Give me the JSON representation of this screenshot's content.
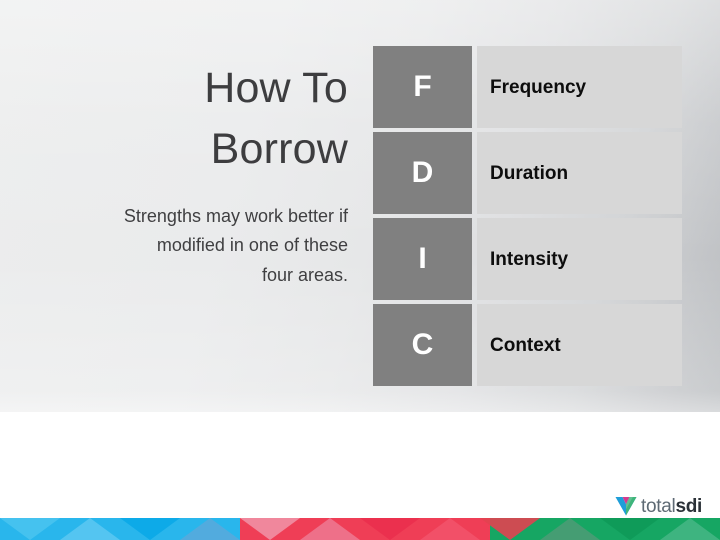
{
  "slide": {
    "title": "How To\nBorrow",
    "subtitle": "Strengths may work better if\nmodified in one of these\nfour areas."
  },
  "table": {
    "rows": [
      {
        "letter": "F",
        "word": "Frequency"
      },
      {
        "letter": "D",
        "word": "Duration"
      },
      {
        "letter": "I",
        "word": "Intensity"
      },
      {
        "letter": "C",
        "word": "Context"
      }
    ]
  },
  "footer": {
    "logo_primary": "total",
    "logo_secondary": "sdi",
    "logo_mark_name": "totalsdi-v-logo-icon"
  },
  "colors": {
    "letter_cell_bg": "#808080",
    "word_cell_bg": "#d7d7d7",
    "title_text": "#3d3d3f",
    "panel_light": "#eceded",
    "panel_dark": "#babdc0",
    "band_blue": "#29b6ec",
    "band_red": "#ef3e56",
    "band_green": "#16a663",
    "logo_total": "#5e6a74",
    "logo_sdi": "#2b3138"
  }
}
